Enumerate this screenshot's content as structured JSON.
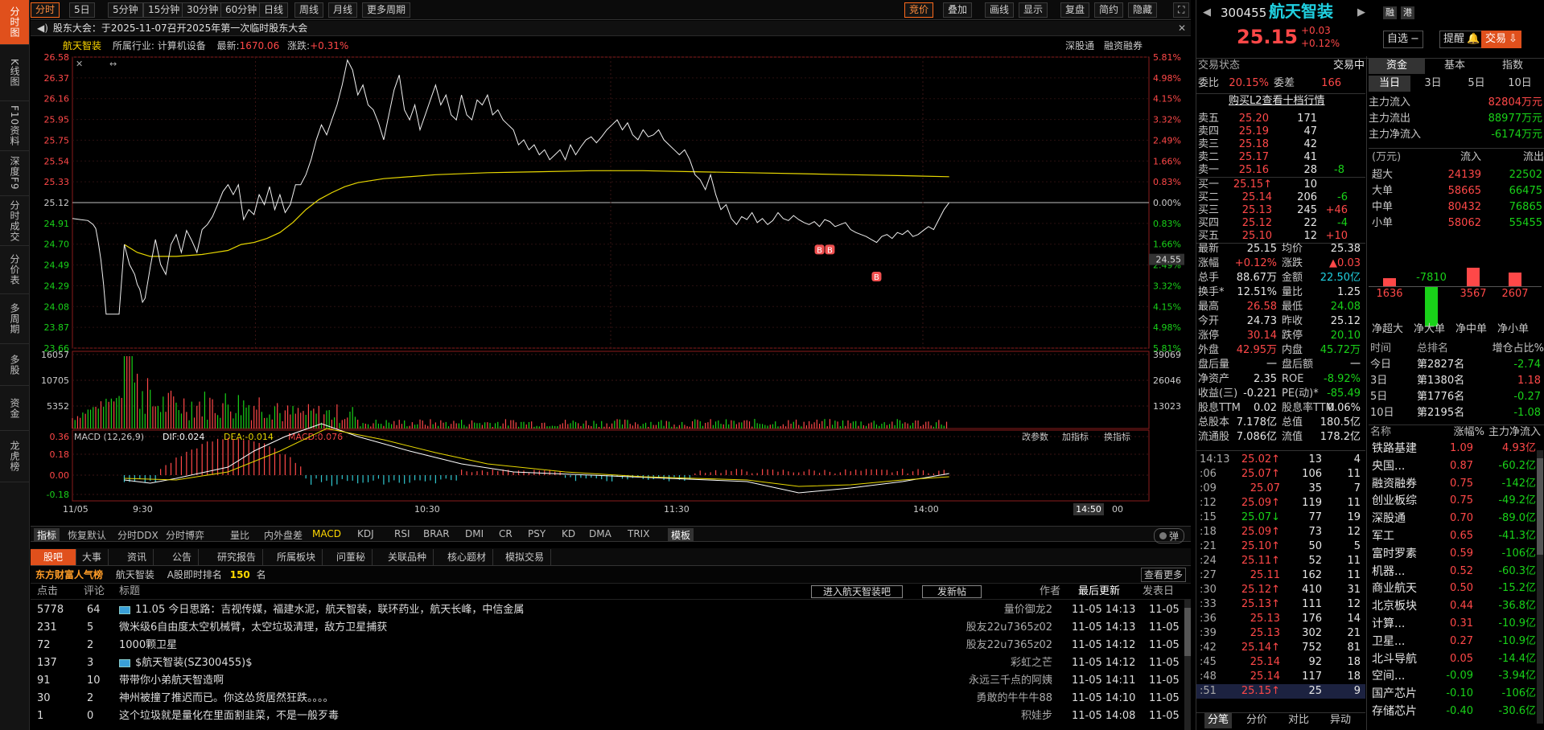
{
  "left_tabs": [
    "分时图",
    "K线图",
    "F10资料",
    "深度F9",
    "分时成交",
    "分价表",
    "多周期",
    "多股",
    "资金",
    "龙虎榜"
  ],
  "toolbar": {
    "periods": [
      "分时",
      "5日",
      "5分钟",
      "15分钟",
      "30分钟",
      "60分钟",
      "日线",
      "周线",
      "月线",
      "更多周期"
    ],
    "right": [
      "竞价",
      "叠加",
      "画线",
      "显示",
      "复盘",
      "简约",
      "隐藏"
    ]
  },
  "notice": "股东大会：于2025-11-07召开2025年第一次临时股东大会",
  "chart_header": {
    "name": "航天智装",
    "industry": "所属行业: 计算机设备",
    "latest_label": "最新:",
    "latest": "1670.06",
    "change_label": "涨跌:",
    "change": "+0.31%",
    "links": [
      "深股通",
      "融资融券"
    ]
  },
  "chart_data": {
    "type": "line",
    "prev_close": 25.12,
    "y_ticks_left": [
      "26.58",
      "26.37",
      "26.16",
      "25.95",
      "25.75",
      "25.54",
      "25.33",
      "25.12",
      "24.91",
      "24.70",
      "24.49",
      "24.29",
      "24.08",
      "23.87",
      "23.66"
    ],
    "y_ticks_right": [
      "5.81%",
      "4.98%",
      "4.15%",
      "3.32%",
      "2.49%",
      "1.66%",
      "0.83%",
      "0.00%",
      "0.83%",
      "1.66%",
      "2.49%",
      "3.32%",
      "4.15%",
      "4.98%",
      "5.81%"
    ],
    "x_ticks": [
      "11/05",
      "9:30",
      "10:30",
      "11:30",
      "14:00"
    ],
    "current_price_tag": "24.55",
    "cursor_time": "14:50",
    "cursor_end": "00",
    "price": [
      [
        0,
        24.96
      ],
      [
        3,
        24.95
      ],
      [
        6,
        24.94
      ],
      [
        8,
        24.9
      ],
      [
        9,
        24.86
      ],
      [
        10,
        24.72
      ],
      [
        11,
        24.54
      ],
      [
        12,
        24.3
      ],
      [
        13,
        24.0
      ],
      [
        15,
        24.0
      ],
      [
        18,
        24.0
      ],
      [
        20,
        24.7
      ],
      [
        22,
        24.5
      ],
      [
        24,
        24.4
      ],
      [
        25,
        24.3
      ],
      [
        26,
        24.25
      ],
      [
        27,
        24.12
      ],
      [
        28,
        24.16
      ],
      [
        30,
        24.47
      ],
      [
        32,
        24.75
      ],
      [
        34,
        24.5
      ],
      [
        36,
        24.4
      ],
      [
        38,
        24.7
      ],
      [
        40,
        24.8
      ],
      [
        42,
        24.62
      ],
      [
        44,
        24.84
      ],
      [
        46,
        24.74
      ],
      [
        48,
        24.62
      ],
      [
        50,
        24.85
      ],
      [
        52,
        24.9
      ],
      [
        54,
        24.98
      ],
      [
        56,
        25.1
      ],
      [
        58,
        25.23
      ],
      [
        60,
        25.3
      ],
      [
        62,
        25.2
      ],
      [
        64,
        25.3
      ],
      [
        66,
        24.95
      ],
      [
        68,
        25.05
      ],
      [
        70,
        25.0
      ],
      [
        72,
        25.2
      ],
      [
        74,
        25.1
      ],
      [
        76,
        25.28
      ],
      [
        78,
        25.05
      ],
      [
        80,
        25.2
      ],
      [
        82,
        25.02
      ],
      [
        84,
        25.1
      ],
      [
        86,
        25.3
      ],
      [
        88,
        25.3
      ],
      [
        90,
        25.4
      ],
      [
        92,
        25.55
      ],
      [
        94,
        25.75
      ],
      [
        96,
        25.9
      ],
      [
        98,
        25.8
      ],
      [
        100,
        25.95
      ],
      [
        102,
        26.1
      ],
      [
        104,
        26.3
      ],
      [
        106,
        26.55
      ],
      [
        108,
        26.45
      ],
      [
        110,
        26.2
      ],
      [
        112,
        26.3
      ],
      [
        114,
        26.1
      ],
      [
        116,
        26.05
      ],
      [
        118,
        25.92
      ],
      [
        120,
        25.75
      ],
      [
        122,
        26.0
      ],
      [
        124,
        26.25
      ],
      [
        126,
        26.4
      ],
      [
        128,
        26.05
      ],
      [
        130,
        25.95
      ],
      [
        132,
        26.1
      ],
      [
        134,
        25.85
      ],
      [
        136,
        26.0
      ],
      [
        138,
        26.15
      ],
      [
        140,
        26.3
      ],
      [
        142,
        26.1
      ],
      [
        144,
        26.2
      ],
      [
        146,
        26.0
      ],
      [
        148,
        25.95
      ],
      [
        150,
        26.2
      ],
      [
        152,
        26.0
      ],
      [
        154,
        25.95
      ],
      [
        156,
        26.15
      ],
      [
        158,
        26.1
      ],
      [
        160,
        26.2
      ],
      [
        162,
        26.0
      ],
      [
        164,
        26.05
      ],
      [
        166,
        25.95
      ],
      [
        168,
        25.9
      ],
      [
        170,
        25.85
      ],
      [
        172,
        25.7
      ],
      [
        174,
        25.75
      ],
      [
        176,
        25.65
      ],
      [
        178,
        25.7
      ],
      [
        180,
        25.6
      ],
      [
        182,
        25.65
      ],
      [
        184,
        25.55
      ],
      [
        186,
        25.6
      ],
      [
        188,
        25.65
      ],
      [
        190,
        25.55
      ],
      [
        192,
        25.7
      ],
      [
        194,
        25.6
      ],
      [
        196,
        25.68
      ],
      [
        198,
        25.75
      ],
      [
        200,
        25.78
      ],
      [
        202,
        25.72
      ],
      [
        204,
        25.78
      ],
      [
        206,
        25.85
      ],
      [
        208,
        25.9
      ],
      [
        210,
        25.95
      ],
      [
        212,
        25.85
      ],
      [
        214,
        25.92
      ],
      [
        216,
        25.8
      ],
      [
        218,
        25.75
      ],
      [
        220,
        25.85
      ],
      [
        222,
        25.78
      ],
      [
        224,
        25.8
      ],
      [
        226,
        25.85
      ],
      [
        228,
        25.75
      ],
      [
        230,
        25.7
      ],
      [
        232,
        25.65
      ],
      [
        234,
        25.6
      ],
      [
        236,
        25.65
      ],
      [
        238,
        25.55
      ],
      [
        240,
        25.4
      ],
      [
        242,
        25.35
      ],
      [
        244,
        25.25
      ],
      [
        246,
        25.4
      ],
      [
        248,
        25.2
      ],
      [
        250,
        25.05
      ],
      [
        252,
        25.1
      ],
      [
        254,
        24.96
      ],
      [
        256,
        24.9
      ],
      [
        258,
        24.98
      ],
      [
        260,
        24.95
      ],
      [
        262,
        25.02
      ],
      [
        264,
        24.92
      ],
      [
        266,
        24.96
      ],
      [
        268,
        24.9
      ],
      [
        270,
        24.94
      ],
      [
        272,
        25.02
      ],
      [
        274,
        24.96
      ],
      [
        276,
        24.94
      ],
      [
        278,
        24.99
      ],
      [
        280,
        24.95
      ],
      [
        282,
        24.92
      ],
      [
        284,
        24.9
      ],
      [
        286,
        24.93
      ],
      [
        288,
        24.88
      ],
      [
        290,
        24.95
      ],
      [
        292,
        24.93
      ],
      [
        294,
        24.88
      ],
      [
        296,
        24.9
      ],
      [
        298,
        24.92
      ],
      [
        300,
        24.85
      ],
      [
        302,
        24.82
      ],
      [
        304,
        24.8
      ],
      [
        306,
        24.78
      ],
      [
        308,
        24.75
      ],
      [
        310,
        24.72
      ],
      [
        312,
        24.78
      ],
      [
        314,
        24.8
      ],
      [
        316,
        24.76
      ],
      [
        318,
        24.82
      ],
      [
        320,
        24.8
      ],
      [
        322,
        24.84
      ],
      [
        324,
        24.78
      ],
      [
        326,
        24.8
      ],
      [
        328,
        24.84
      ],
      [
        330,
        24.88
      ],
      [
        332,
        24.85
      ],
      [
        334,
        24.95
      ],
      [
        336,
        25.05
      ],
      [
        338,
        25.12
      ]
    ],
    "avg": [
      [
        20,
        24.7
      ],
      [
        25,
        24.62
      ],
      [
        30,
        24.58
      ],
      [
        40,
        24.58
      ],
      [
        50,
        24.6
      ],
      [
        60,
        24.64
      ],
      [
        65,
        24.7
      ],
      [
        70,
        24.72
      ],
      [
        75,
        24.76
      ],
      [
        80,
        24.82
      ],
      [
        85,
        24.92
      ],
      [
        90,
        25.05
      ],
      [
        95,
        25.15
      ],
      [
        100,
        25.22
      ],
      [
        105,
        25.28
      ],
      [
        110,
        25.32
      ],
      [
        120,
        25.36
      ],
      [
        140,
        25.4
      ],
      [
        160,
        25.42
      ],
      [
        180,
        25.43
      ],
      [
        200,
        25.44
      ],
      [
        220,
        25.44
      ],
      [
        240,
        25.43
      ],
      [
        260,
        25.42
      ],
      [
        280,
        25.41
      ],
      [
        300,
        25.4
      ],
      [
        320,
        25.39
      ],
      [
        338,
        25.38
      ]
    ],
    "volume_ticks_left": [
      "16057",
      "10705",
      "5352"
    ],
    "volume_ticks_right": [
      "39069",
      "26046",
      "13023"
    ],
    "macd_header": {
      "name": "MACD (12,26,9)",
      "dif": "DIF:0.024",
      "dea": "DEA:-0.014",
      "macd": "MACD:0.076",
      "links": [
        "改参数",
        "加指标",
        "换指标"
      ]
    },
    "macd_ticks": [
      "0.36",
      "0.18",
      "0.00",
      "-0.18"
    ],
    "markers": [
      "B",
      "B",
      "B"
    ]
  },
  "indicator_tabs": [
    "指标",
    "恢复默认",
    "分时DDX",
    "分时博弈",
    "量比",
    "内外盘差",
    "MACD",
    "KDJ",
    "RSI",
    "BRAR",
    "DMI",
    "CR",
    "PSY",
    "KD",
    "DMA",
    "TRIX",
    "模板"
  ],
  "popup_label": "弹",
  "forum": {
    "tabs": [
      "股吧",
      "大事",
      "资讯",
      "公告",
      "研究报告",
      "所属板块",
      "问董秘",
      "关联品种",
      "核心题材",
      "模拟交易"
    ],
    "brand": "东方财富人气榜",
    "stock": "航天智装",
    "rank_label": "A股即时排名",
    "rank": "150",
    "rank_unit": "名",
    "more": "查看更多",
    "cols": [
      "点击",
      "评论",
      "标题",
      "作者",
      "最后更新",
      "发表日"
    ],
    "btn_enter": "进入航天智装吧",
    "btn_post": "发新帖",
    "rows": [
      {
        "clicks": "5778",
        "comments": "64",
        "title": "11.05 今日思路：吉视传媒，福建水泥，航天智装，联环药业，航天长峰，中信金属",
        "author": "量价御龙2",
        "updated": "11-05 14:13",
        "date": "11-05",
        "icon": true
      },
      {
        "clicks": "231",
        "comments": "5",
        "title": "微米级6自由度太空机械臂，太空垃圾清理，敌方卫星捕获",
        "author": "股友22u7365z02",
        "updated": "11-05 14:13",
        "date": "11-05",
        "icon": false
      },
      {
        "clicks": "72",
        "comments": "2",
        "title": "1000颗卫星",
        "author": "股友22u7365z02",
        "updated": "11-05 14:12",
        "date": "11-05",
        "icon": false
      },
      {
        "clicks": "137",
        "comments": "3",
        "title": "$航天智装(SZ300455)$",
        "author": "彩虹之芒",
        "updated": "11-05 14:12",
        "date": "11-05",
        "icon": true
      },
      {
        "clicks": "91",
        "comments": "10",
        "title": "带带你小弟航天智造啊",
        "author": "永远三千点的阿姨",
        "updated": "11-05 14:11",
        "date": "11-05",
        "icon": false
      },
      {
        "clicks": "30",
        "comments": "2",
        "title": "神州被撞了推迟而已。你这怂货居然狂跌。。。。",
        "author": "勇敢的牛牛牛88",
        "updated": "11-05 14:10",
        "date": "11-05",
        "icon": false
      },
      {
        "clicks": "1",
        "comments": "0",
        "title": "这个垃圾就是量化在里面割韭菜，不是一般歹毒",
        "author": "积娃步",
        "updated": "11-05 14:08",
        "date": "11-05",
        "icon": false
      }
    ]
  },
  "quote": {
    "code": "300455",
    "name": "航天智装",
    "price": "25.15",
    "chg": "+0.03",
    "pct": "+0.12%",
    "buttons": [
      "融",
      "港",
      "自选",
      "提醒",
      "交易"
    ],
    "status_label": "交易状态",
    "status": "交易中",
    "webi_label": "委比",
    "webi": "20.15%",
    "weicha_label": "委差",
    "weicha": "166",
    "l2": "购买L2查看十档行情",
    "asks": [
      {
        "l": "卖五",
        "p": "25.20",
        "v": "171",
        "d": ""
      },
      {
        "l": "卖四",
        "p": "25.19",
        "v": "47",
        "d": ""
      },
      {
        "l": "卖三",
        "p": "25.18",
        "v": "42",
        "d": ""
      },
      {
        "l": "卖二",
        "p": "25.17",
        "v": "41",
        "d": ""
      },
      {
        "l": "卖一",
        "p": "25.16",
        "v": "28",
        "d": "-8"
      }
    ],
    "bids": [
      {
        "l": "买一",
        "p": "25.15↑",
        "v": "10",
        "d": ""
      },
      {
        "l": "买二",
        "p": "25.14",
        "v": "206",
        "d": "-6"
      },
      {
        "l": "买三",
        "p": "25.13",
        "v": "245",
        "d": "+46"
      },
      {
        "l": "买四",
        "p": "25.12",
        "v": "22",
        "d": "-4"
      },
      {
        "l": "买五",
        "p": "25.10",
        "v": "12",
        "d": "+10"
      }
    ],
    "stats": [
      [
        "最新",
        "25.15",
        "均价",
        "25.38"
      ],
      [
        "涨幅",
        "+0.12%",
        "涨跌",
        "▲0.03"
      ],
      [
        "总手",
        "88.67万",
        "金额",
        "22.50亿"
      ],
      [
        "换手*",
        "12.51%",
        "量比",
        "1.25"
      ],
      [
        "最高",
        "26.58",
        "最低",
        "24.08"
      ],
      [
        "今开",
        "24.73",
        "昨收",
        "25.12"
      ],
      [
        "涨停",
        "30.14",
        "跌停",
        "20.10"
      ],
      [
        "外盘",
        "42.95万",
        "内盘",
        "45.72万"
      ],
      [
        "盘后量",
        "一",
        "盘后额",
        "一"
      ],
      [
        "净资产",
        "2.35",
        "ROE",
        "-8.92%"
      ],
      [
        "收益(三)",
        "-0.221",
        "PE(动)*",
        "-85.49"
      ],
      [
        "股息TTM",
        "0.02",
        "股息率TTM",
        "0.06%"
      ],
      [
        "总股本",
        "7.178亿",
        "总值",
        "180.5亿"
      ],
      [
        "流通股",
        "7.086亿",
        "流值",
        "178.2亿"
      ]
    ],
    "ticks": [
      [
        "14:13",
        "25.02↑",
        "13",
        "4"
      ],
      [
        ":06",
        "25.07↑",
        "106",
        "11"
      ],
      [
        ":09",
        "25.07",
        "35",
        "7"
      ],
      [
        ":12",
        "25.09↑",
        "119",
        "11"
      ],
      [
        ":15",
        "25.07↓",
        "77",
        "19"
      ],
      [
        ":18",
        "25.09↑",
        "73",
        "12"
      ],
      [
        ":21",
        "25.10↑",
        "50",
        "5"
      ],
      [
        ":24",
        "25.11↑",
        "52",
        "11"
      ],
      [
        ":27",
        "25.11",
        "162",
        "11"
      ],
      [
        ":30",
        "25.12↑",
        "410",
        "31"
      ],
      [
        ":33",
        "25.13↑",
        "111",
        "12"
      ],
      [
        ":36",
        "25.13",
        "176",
        "14"
      ],
      [
        ":39",
        "25.13",
        "302",
        "21"
      ],
      [
        ":42",
        "25.14↑",
        "752",
        "81"
      ],
      [
        ":45",
        "25.14",
        "92",
        "18"
      ],
      [
        ":48",
        "25.14",
        "117",
        "18"
      ],
      [
        ":51",
        "25.15↑",
        "25",
        "9"
      ]
    ],
    "bottom_tabs": [
      "分笔",
      "分价",
      "对比",
      "异动"
    ]
  },
  "fund": {
    "tabs": [
      "资金",
      "基本",
      "指数"
    ],
    "periods": [
      "当日",
      "3日",
      "5日",
      "10日"
    ],
    "main": [
      [
        "主力流入",
        "82804万元"
      ],
      [
        "主力流出",
        "88977万元"
      ],
      [
        "主力净流入",
        "-6174万元"
      ]
    ],
    "table_head": [
      "(万元)",
      "流入",
      "流出"
    ],
    "table": [
      [
        "超大",
        "24139",
        "22502"
      ],
      [
        "大单",
        "58665",
        "66475"
      ],
      [
        "中单",
        "80432",
        "76865"
      ],
      [
        "小单",
        "58062",
        "55455"
      ]
    ],
    "bars": [
      {
        "label": "净超大",
        "v": 1636
      },
      {
        "label": "净大单",
        "v": -7810
      },
      {
        "label": "净中单",
        "v": 3567
      },
      {
        "label": "净小单",
        "v": 2607
      }
    ],
    "rank_head": [
      "时间",
      "总排名",
      "增仓占比%"
    ],
    "rank": [
      [
        "今日",
        "第2827名",
        "-2.74"
      ],
      [
        "3日",
        "第1380名",
        "1.18"
      ],
      [
        "5日",
        "第1776名",
        "-0.27"
      ],
      [
        "10日",
        "第2195名",
        "-1.08"
      ]
    ],
    "sector_head": [
      "名称",
      "涨幅%",
      "主力净流入"
    ],
    "sectors": [
      [
        "铁路基建",
        "1.09",
        "4.93亿"
      ],
      [
        "央国...",
        "0.87",
        "-60.2亿"
      ],
      [
        "融资融券",
        "0.75",
        "-142亿"
      ],
      [
        "创业板综",
        "0.75",
        "-49.2亿"
      ],
      [
        "深股通",
        "0.70",
        "-89.0亿"
      ],
      [
        "军工",
        "0.65",
        "-41.3亿"
      ],
      [
        "富时罗素",
        "0.59",
        "-106亿"
      ],
      [
        "机器...",
        "0.52",
        "-60.3亿"
      ],
      [
        "商业航天",
        "0.50",
        "-15.2亿"
      ],
      [
        "北京板块",
        "0.44",
        "-36.8亿"
      ],
      [
        "计算...",
        "0.31",
        "-10.9亿"
      ],
      [
        "卫星...",
        "0.27",
        "-10.9亿"
      ],
      [
        "北斗导航",
        "0.05",
        "-14.4亿"
      ],
      [
        "空间...",
        "-0.09",
        "-3.94亿"
      ],
      [
        "国产芯片",
        "-0.10",
        "-106亿"
      ],
      [
        "存储芯片",
        "-0.40",
        "-30.6亿"
      ]
    ]
  }
}
